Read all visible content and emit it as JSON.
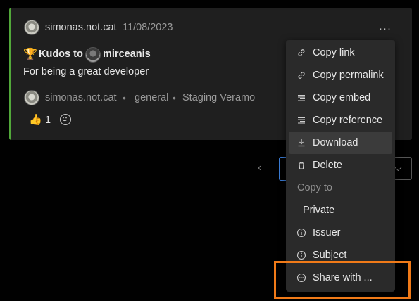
{
  "post": {
    "author": "simonas.not.cat",
    "date": "11/08/2023",
    "more_label": "···",
    "trophy": "🏆",
    "kudos_label": "Kudos to",
    "mention": "mirceanis",
    "body": "For being a great developer",
    "meta_author": "simonas.not.cat",
    "meta_separator": "•",
    "meta_channel": "general",
    "meta_agent": "Staging Veramo",
    "reaction_emoji": "👍",
    "reaction_count": "1"
  },
  "pager": {
    "prev_label": "‹",
    "select_chevron": "⌵"
  },
  "menu": {
    "items": [
      {
        "label": "Copy link",
        "icon": "link-icon"
      },
      {
        "label": "Copy permalink",
        "icon": "link-icon"
      },
      {
        "label": "Copy embed",
        "icon": "embed-icon"
      },
      {
        "label": "Copy reference",
        "icon": "reference-icon"
      },
      {
        "label": "Download",
        "icon": "download-icon"
      },
      {
        "label": "Delete",
        "icon": "trash-icon"
      }
    ],
    "section_label": "Copy to",
    "private_label": "Private",
    "share_items": [
      {
        "label": "Issuer",
        "icon": "info-icon"
      },
      {
        "label": "Subject",
        "icon": "info-icon"
      },
      {
        "label": "Share with ...",
        "icon": "share-icon"
      }
    ]
  },
  "colors": {
    "accent_border": "#52a83a",
    "highlight": "#f07a18",
    "focus_blue": "#3a7bd5"
  }
}
